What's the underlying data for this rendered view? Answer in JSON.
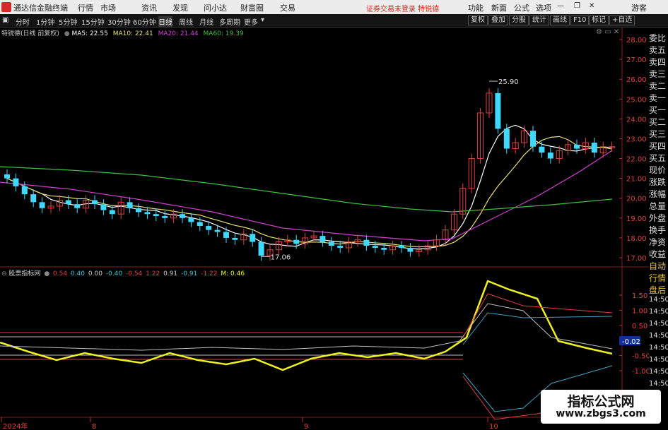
{
  "titlebar": {
    "app_title": "通达信金融终端",
    "menus": [
      "行情",
      "市场",
      "资讯",
      "发现",
      "问小达",
      "财富圈",
      "交易"
    ],
    "notice": "证券交易未登录  特锐德",
    "right_items": [
      "功能",
      "新面",
      "公式",
      "选项"
    ],
    "guest": "游客"
  },
  "toolbar": {
    "periods": [
      "分时",
      "1分钟",
      "5分钟",
      "15分钟",
      "30分钟",
      "60分钟",
      "日线",
      "周线",
      "月线",
      "多周期",
      "更多"
    ],
    "active_period": "日线",
    "right_buttons": [
      "复权",
      "叠加",
      "分股",
      "统计",
      "画线",
      "F10",
      "标记",
      "+自选"
    ]
  },
  "price_legend": {
    "name": "特锐德(日线 前复权)",
    "ma5": "MA5: 22.55",
    "ma10": "MA10: 22.41",
    "ma20": "MA20: 21.44",
    "ma60": "MA60: 19.39"
  },
  "indicator_legend": {
    "name": "股票指标网",
    "values": [
      "0.54",
      "0.40",
      "0.00",
      "-0.40",
      "-0.54",
      "1.22",
      "0.91",
      "-0.91",
      "-1.22",
      "M: 0.46"
    ]
  },
  "price_axis": [
    "28.00",
    "27.00",
    "26.00",
    "25.00",
    "24.00",
    "23.00",
    "22.00",
    "21.00",
    "20.00",
    "19.00",
    "18.00",
    "17.00"
  ],
  "indicator_axis": [
    "1.50",
    "1.00",
    "0.50",
    "-0.02",
    "-0.50",
    "-1.00"
  ],
  "indicator_current": "-0.02",
  "time_labels": [
    "2024年",
    "8",
    "9",
    "10"
  ],
  "annotations": {
    "high": "25.90",
    "low": "17.06"
  },
  "sidebar": [
    "委比",
    "卖五",
    "卖四",
    "卖三",
    "卖二",
    "卖一",
    "买一",
    "买二",
    "买三",
    "买四",
    "买五",
    "现价",
    "涨跌",
    "涨幅",
    "总量",
    "外盘",
    "换手",
    "净资",
    "收益",
    "自动",
    "行情",
    "盘后",
    "14:50",
    "14:50",
    "14:50",
    "14:50",
    "14:50",
    "14:50",
    "14:50",
    "14:50"
  ],
  "watermark": {
    "top": "指标公式网",
    "bottom": "www.zbgs3.com"
  },
  "colors": {
    "up": "#e04040",
    "down": "#40d8ff",
    "ma5": "#ffffff",
    "ma10": "#e8e070",
    "ma20": "#d040d0",
    "ma60": "#40c040",
    "signal": "#f0f020"
  }
}
